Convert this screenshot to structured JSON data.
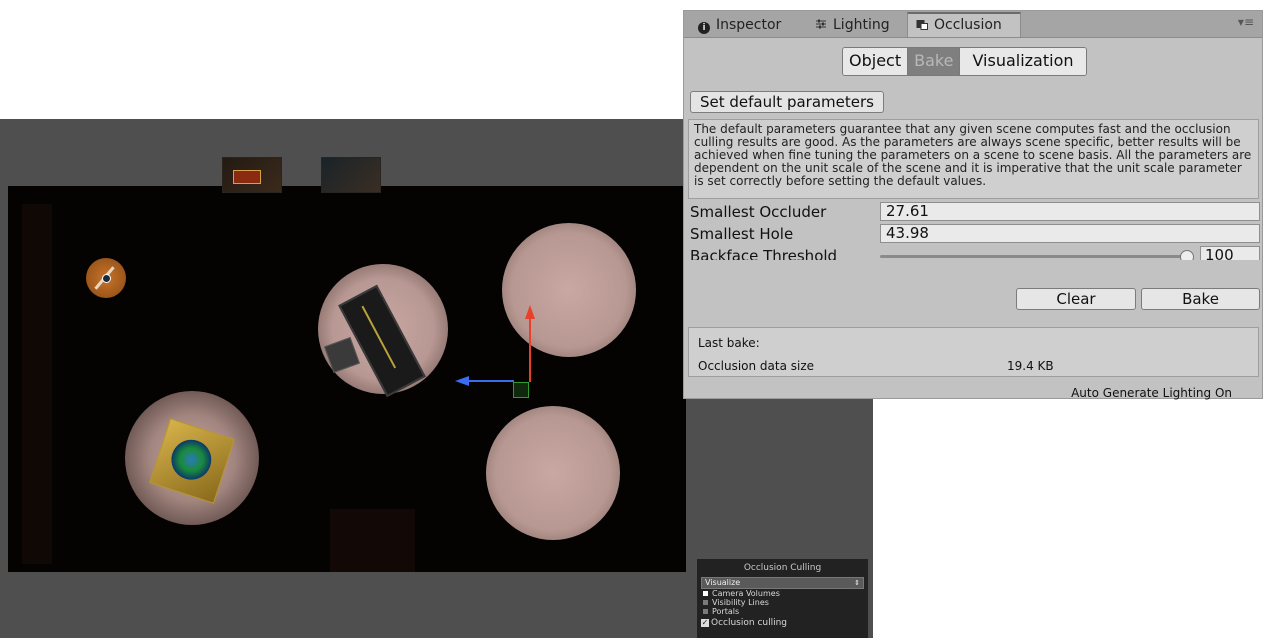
{
  "inspector": {
    "tabs": [
      {
        "label": "Inspector",
        "icon": "info-icon"
      },
      {
        "label": "Lighting",
        "icon": "lighting-sliders-icon"
      },
      {
        "label": "Occlusion",
        "icon": "occlusion-icon",
        "active": true
      }
    ],
    "mode_buttons": [
      {
        "label": "Object",
        "selected": false
      },
      {
        "label": "Bake",
        "selected": true
      },
      {
        "label": "Visualization",
        "selected": false
      }
    ],
    "set_default_label": "Set default parameters",
    "help_text": "The default parameters guarantee that any given scene computes fast and the occlusion culling results are good. As the parameters are always scene specific, better results will be achieved when fine tuning the parameters on a scene to scene basis. All the parameters are dependent on the unit scale of the scene and it is imperative that the unit scale parameter is set correctly before setting the default values.",
    "fields": {
      "smallest_occluder": {
        "label": "Smallest Occluder",
        "value": "27.61"
      },
      "smallest_hole": {
        "label": "Smallest Hole",
        "value": "43.98"
      },
      "backface_threshold": {
        "label": "Backface Threshold",
        "value": "100",
        "level": 1.0
      }
    },
    "clear_label": "Clear",
    "bake_label": "Bake",
    "last_bake": {
      "title": "Last bake:",
      "data_size_label": "Occlusion data size",
      "data_size_value": "19.4 KB"
    },
    "status": "Auto Generate Lighting On"
  },
  "occlusion_overlay": {
    "title": "Occlusion Culling",
    "select_value": "Visualize",
    "items": [
      {
        "label": "Camera Volumes",
        "color": "#ffffff"
      },
      {
        "label": "Visibility Lines",
        "color": "#7a7a7a"
      },
      {
        "label": "Portals",
        "color": "#7a7a7a"
      }
    ],
    "checkbox_label": "Occlusion culling",
    "checkbox_checked": true
  },
  "colors": {
    "scene_bg": "#4f4f4f",
    "floor": "#050302",
    "spotlight": "#c9a7a3",
    "gizmo_y": "#e8402a",
    "gizmo_x": "#3a6cf0",
    "gizmo_center": "#2f9a2f"
  }
}
